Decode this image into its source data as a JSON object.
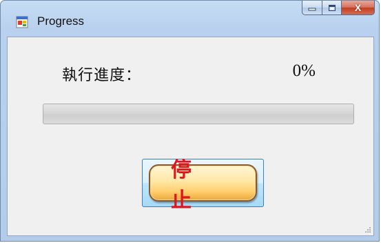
{
  "window": {
    "title": "Progress",
    "app_icon": "windows-form-icon",
    "caption_buttons": {
      "minimize_icon": "minimize-icon",
      "maximize_icon": "maximize-icon",
      "close_glyph": "X"
    }
  },
  "content": {
    "progress_label": "執行進度：",
    "percent_text": "0%",
    "progress_value": 0,
    "stop_button_label": "停 止"
  },
  "colors": {
    "button_text": "#e0161e",
    "button_face": "#ffe7a6",
    "client_background": "#f0f0f0",
    "titlebar": "#b9d1ee"
  }
}
